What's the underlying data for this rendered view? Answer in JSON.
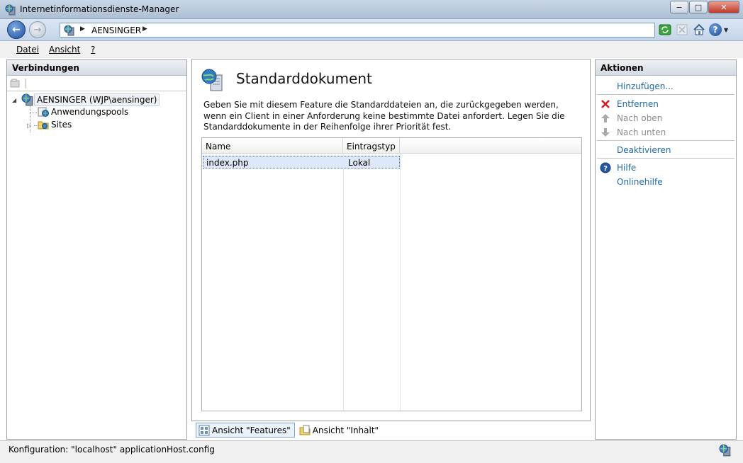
{
  "window": {
    "title": "Internetinformationsdienste-Manager",
    "minimize_glyph": "−",
    "maximize_glyph": "□",
    "close_glyph": "✕"
  },
  "navigation": {
    "back_glyph": "←",
    "forward_glyph": "→",
    "breadcrumb": "AENSINGER",
    "help_glyph": "?"
  },
  "menu": {
    "file": "Datei",
    "view": "Ansicht",
    "help": "?"
  },
  "connections": {
    "header": "Verbindungen",
    "tree": {
      "server": "AENSINGER (WJP\\aensinger)",
      "app_pools": "Anwendungspools",
      "sites": "Sites"
    }
  },
  "feature": {
    "title": "Standarddokument",
    "description": "Geben Sie mit diesem Feature die Standarddateien an, die zurückgegeben werden, wenn ein Client in einer Anforderung keine bestimmte Datei anfordert. Legen Sie die Standarddokumente in der Reihenfolge ihrer Priorität fest.",
    "columns": {
      "name": "Name",
      "type": "Eintragstyp"
    },
    "rows": [
      {
        "name": "index.php",
        "type": "Lokal"
      }
    ]
  },
  "view_tabs": {
    "features": "Ansicht \"Features\"",
    "content": "Ansicht \"Inhalt\""
  },
  "actions": {
    "header": "Aktionen",
    "add": "Hinzufügen...",
    "remove": "Entfernen",
    "move_up": "Nach oben",
    "move_down": "Nach unten",
    "disable": "Deaktivieren",
    "help": "Hilfe",
    "online_help": "Onlinehilfe"
  },
  "status": {
    "text": "Konfiguration: \"localhost\" applicationHost.config"
  },
  "colors": {
    "link": "#1f6aa5",
    "disabled": "#8c8c8c",
    "remove_icon": "#d42020"
  }
}
